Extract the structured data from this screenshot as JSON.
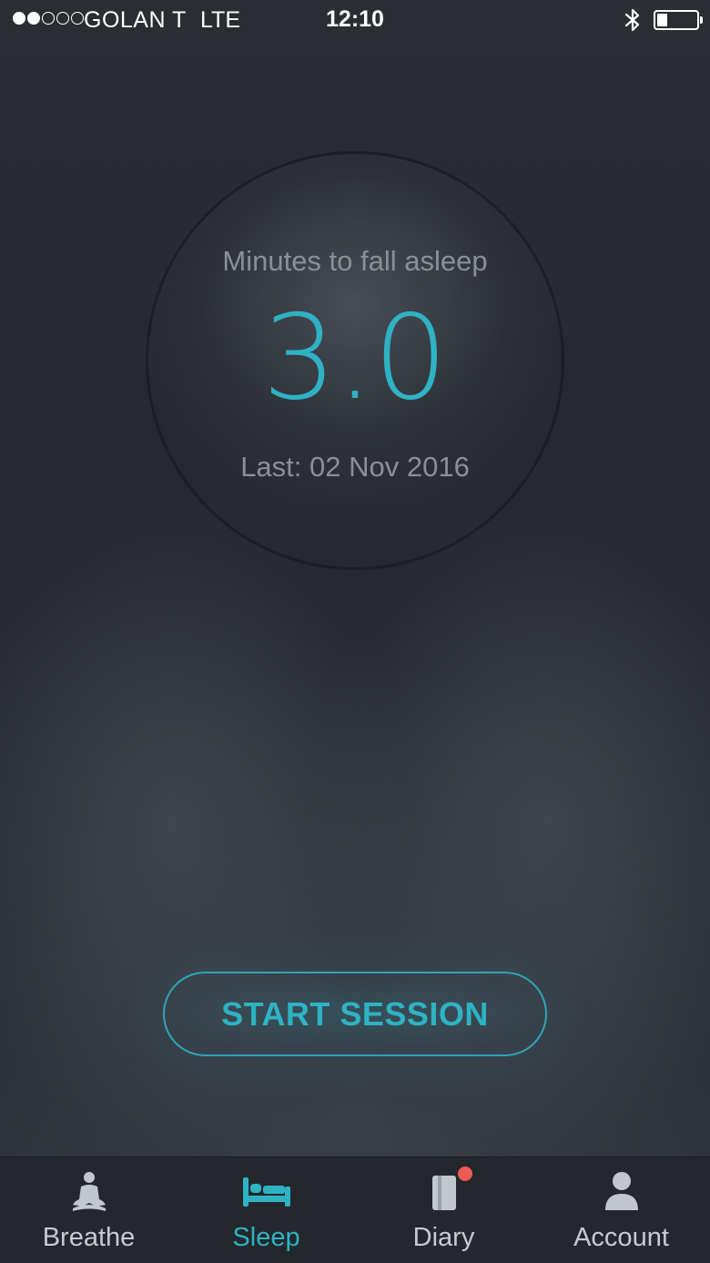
{
  "status_bar": {
    "carrier": "GOLAN T",
    "network": "LTE",
    "time": "12:10",
    "signal_dots_filled": 2,
    "signal_dots_total": 5,
    "bluetooth_icon": "bluetooth-icon",
    "battery_level": 0.25
  },
  "dial": {
    "label": "Minutes to fall asleep",
    "value": "3.0",
    "last": "Last: 02 Nov 2016"
  },
  "start_button": {
    "label": "START SESSION"
  },
  "tabs": [
    {
      "label": "Breathe",
      "icon": "meditation-icon",
      "active": false
    },
    {
      "label": "Sleep",
      "icon": "bed-icon",
      "active": true
    },
    {
      "label": "Diary",
      "icon": "diary-icon",
      "active": false,
      "badge": true
    },
    {
      "label": "Account",
      "icon": "person-icon",
      "active": false
    }
  ],
  "colors": {
    "accent": "#2fb2c4",
    "background": "#25292e",
    "muted_text": "#8b9097",
    "badge": "#ee5a5a"
  }
}
